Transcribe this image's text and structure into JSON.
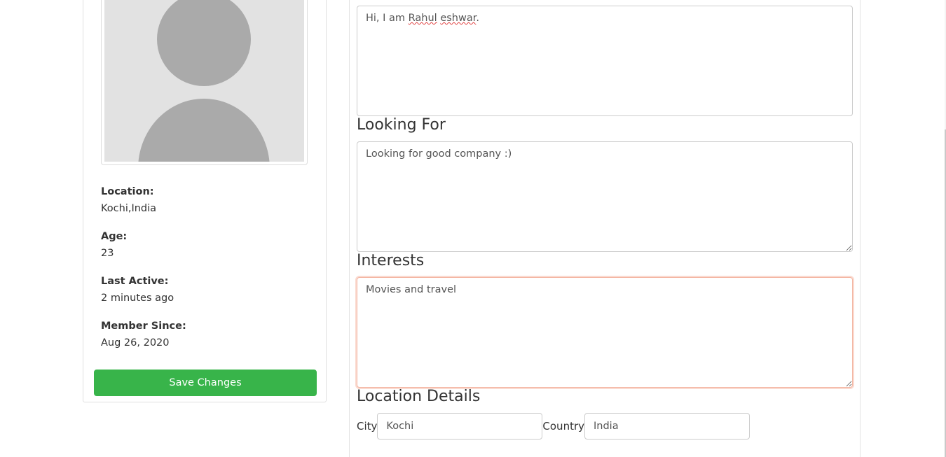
{
  "profile": {
    "photo_alt": "User profile photo placeholder",
    "location": {
      "label": "Location:",
      "value": "Kochi,India"
    },
    "age": {
      "label": "Age:",
      "value": "23"
    },
    "last_active": {
      "label": "Last Active:",
      "value": "2 minutes ago"
    },
    "member_since": {
      "label": "Member Since:",
      "value": "Aug 26, 2020"
    },
    "save_label": "Save Changes"
  },
  "edit": {
    "introduction": {
      "text_before": "Hi, I am ",
      "misspelled_1": "Rahul",
      "misspelled_2": "eshwar",
      "text_after": "."
    },
    "looking_for": {
      "heading": "Looking For",
      "value": "Looking for good company :)"
    },
    "interests": {
      "heading": "Interests",
      "value": "Movies and travel"
    },
    "location_details": {
      "heading": "Location Details",
      "city_label": "City",
      "city_value": "Kochi",
      "country_label": "Country",
      "country_value": "India"
    }
  },
  "colors": {
    "save_button": "#38b44a",
    "focus_ring": "#f4b6a3",
    "avatar_silhouette": "#aaaaaa",
    "avatar_background": "#e2e2e2"
  }
}
